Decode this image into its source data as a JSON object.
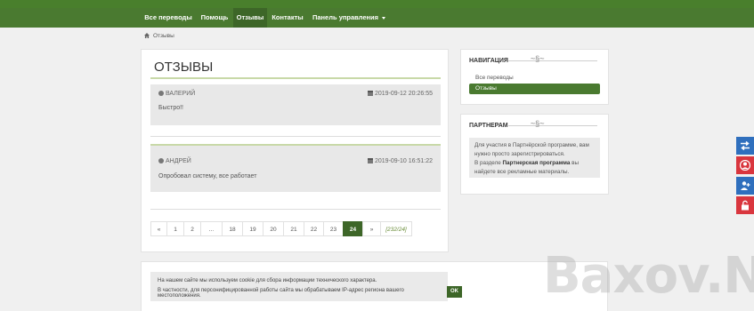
{
  "nav": {
    "items": [
      {
        "label": "Все переводы"
      },
      {
        "label": "Помощь"
      },
      {
        "label": "Отзывы"
      },
      {
        "label": "Контакты"
      },
      {
        "label": "Панель управления"
      }
    ]
  },
  "breadcrumb": {
    "current": "Отзывы"
  },
  "main": {
    "title": "ОТЗЫВЫ",
    "reviews": [
      {
        "author": "ВАЛЕРИЙ",
        "date": "2019-09-12 20:26:55",
        "text": "Быстро!!"
      },
      {
        "author": "АНДРЕЙ",
        "date": "2019-09-10 16:51:22",
        "text": "Опробовал систему, все работает"
      }
    ]
  },
  "pagination": {
    "prev": "«",
    "pages": [
      "1",
      "2",
      "...",
      "18",
      "19",
      "20",
      "21",
      "22",
      "23",
      "24"
    ],
    "current": "24",
    "next": "»",
    "info": "[232/24]"
  },
  "sidebar": {
    "nav_title": "НАВИГАЦИЯ",
    "links": [
      {
        "label": "Все переводы"
      },
      {
        "label": "Отзывы"
      }
    ],
    "partners_title": "ПАРТНЕРАМ",
    "partners_text_1": "Для участия в Партнёрской программе, вам нужно просто зарегистрироваться.",
    "partners_text_2_pre": "В разделе ",
    "partners_text_2_bold": "Партнерская программа",
    "partners_text_2_post": " вы найдете все рекламные материалы."
  },
  "cookie": {
    "line1": "На нашем сайте мы используем cookie для сбора информации технического характера.",
    "line2": "В частности, для персонифицированной работы сайта мы обрабатываем IP-адрес региона вашего местоположения.",
    "ok": "OK"
  },
  "watermark": "Baxov.Net",
  "colors": {
    "brand_green": "#4a7a30",
    "float_blue": "#2f6fbd",
    "float_red": "#d9363e"
  }
}
